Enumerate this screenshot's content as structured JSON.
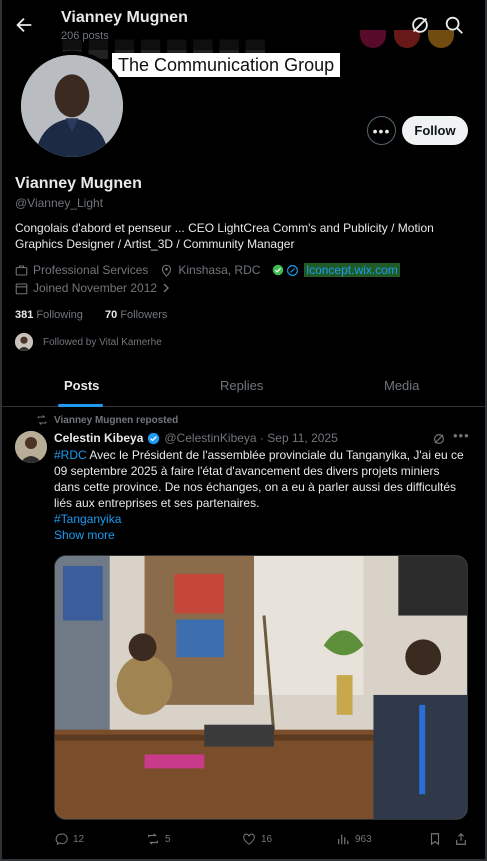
{
  "header": {
    "name": "Vianney Mugnen",
    "posts_count": "206 posts"
  },
  "banner": {
    "label": "The Communication Group"
  },
  "profile": {
    "name": "Vianney Mugnen",
    "handle": "@Vianney_Light",
    "bio": "Congolais d'abord et penseur ... CEO LightCrea Comm's and Publicity / Motion Graphics Designer / Artist_3D / Community Manager",
    "category": "Professional Services",
    "location": "Kinshasa, RDC",
    "website": "lconcept.wix.com",
    "joined": "Joined November 2012",
    "following_count": "381",
    "following_label": "Following",
    "followers_count": "70",
    "followers_label": "Followers",
    "followed_by": "Followed by Vital Kamerhe"
  },
  "buttons": {
    "follow": "Follow",
    "more": "•••"
  },
  "tabs": [
    {
      "label": "Posts"
    },
    {
      "label": "Replies"
    },
    {
      "label": "Media"
    }
  ],
  "post": {
    "repost_label": "Vianney Mugnen reposted",
    "author": "Celestin Kibeya",
    "handle_date": "@CelestinKibeya · Sep 11, 2025",
    "hashtag1": "#RDC",
    "text": " Avec le Président de l'assemblée provinciale du Tanganyika, J'ai eu ce 09 septembre 2025 à faire l'état d'avancement des divers projets miniers  dans cette province. De nos échanges, on a eu à parler aussi des difficultés liés aux entreprises et ses partenaires.",
    "hashtag2": "#Tanganyika",
    "show_more": "Show more",
    "replies": "12",
    "reposts": "5",
    "likes": "16",
    "views": "963"
  },
  "colors": {
    "accent": "#1d9bf0",
    "background": "#000000",
    "muted": "#71767b",
    "link_highlight": "#1f5a27"
  }
}
